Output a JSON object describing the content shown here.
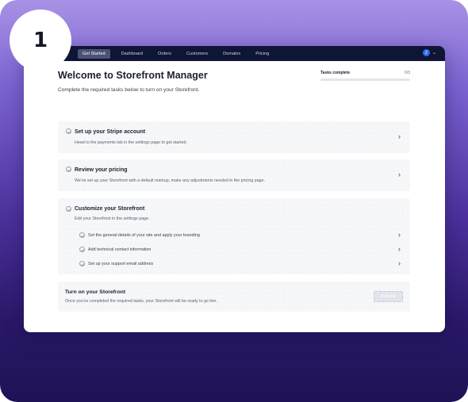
{
  "step": {
    "number": "1"
  },
  "navbar": {
    "items": [
      {
        "label": "Get Started",
        "active": true
      },
      {
        "label": "Dashboard"
      },
      {
        "label": "Orders"
      },
      {
        "label": "Customers"
      },
      {
        "label": "Domains"
      },
      {
        "label": "Pricing"
      }
    ],
    "avatar_initial": "Z",
    "avatar_color": "#2f6bf0",
    "menu_icon": "chevron-down-icon"
  },
  "header": {
    "title": "Welcome to Storefront Manager",
    "subtitle": "Complete the required tasks below to turn on your Storefront."
  },
  "tasks": {
    "label": "Tasks complete",
    "count": "0/3",
    "progress": 0
  },
  "cards": [
    {
      "title": "Set up your Stripe account",
      "description": "Head to the payments tab in the settings page to get started."
    },
    {
      "title": "Review your pricing",
      "description": "We've set up your Storefront with a default markup, make any adjustments needed in the pricing page."
    },
    {
      "title": "Customize your Storefront",
      "description": "Edit your Storefront in the settings page.",
      "subtasks": [
        {
          "label": "Set the general details of your site and apply your branding"
        },
        {
          "label": "Add technical contact information"
        },
        {
          "label": "Set up your support email address"
        }
      ]
    }
  ],
  "launch": {
    "title": "Turn on your Storefront",
    "description": "Once you've completed the required tasks, your Storefront will be ready to go live.",
    "button_label": "Activate"
  },
  "colors": {
    "navbar_bg": "#0f1534",
    "accent": "#2f6bf0",
    "background_gradient_top": "#a892e6",
    "background_gradient_bottom": "#1f1255"
  }
}
